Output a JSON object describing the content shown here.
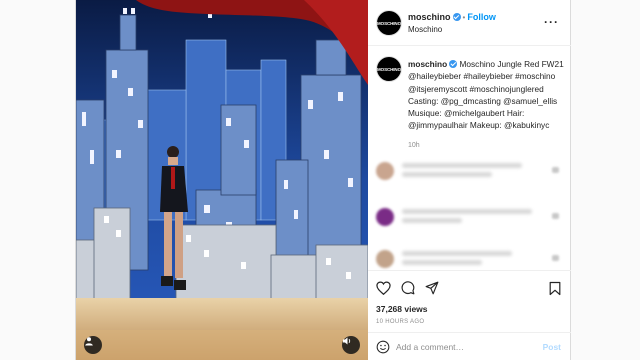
{
  "header": {
    "username": "moschino",
    "subtitle": "Moschino",
    "separator": "•",
    "follow_label": "Follow",
    "more_label": "···",
    "avatar_text": "MOSCHINO"
  },
  "caption": {
    "username": "moschino",
    "text": "Moschino Jungle Red FW21 @haileybieber #haileybieber #moschino @itsjeremyscott #moschinojunglered Casting: @pg_dmcasting @samuel_ellis Musique: @michelgaubert Hair: @jimmypaulhair Makeup: @kabukinyc",
    "time": "10h"
  },
  "blurred_comments": [
    {
      "avatar_color": "#c9a58f",
      "line1": 120,
      "line2": 90
    },
    {
      "avatar_color": "#7a2b86",
      "line1": 130,
      "line2": 60
    },
    {
      "avatar_color": "#c2a38a",
      "line1": 110,
      "line2": 80
    }
  ],
  "actions": {
    "like_icon": "heart-icon",
    "comment_icon": "comment-icon",
    "share_icon": "share-icon",
    "save_icon": "bookmark-icon"
  },
  "stats": {
    "views": "37,268 views",
    "time_ago": "10 HOURS AGO"
  },
  "comment_box": {
    "placeholder": "Add a comment…",
    "post_label": "Post",
    "emoji_icon": "emoji-icon"
  },
  "media": {
    "user_tag_icon": "user-tag-icon",
    "sound_icon": "speaker-icon"
  },
  "colors": {
    "accent": "#0095f6",
    "verified": "#3897f0",
    "post_disabled": "#b3dbff"
  }
}
